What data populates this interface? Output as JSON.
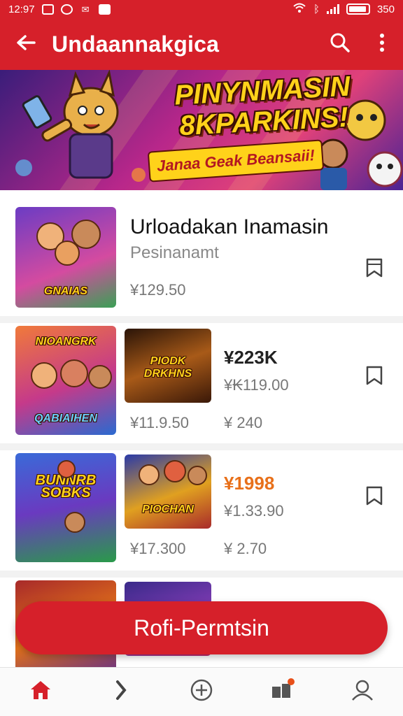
{
  "status_bar": {
    "time": "12:97",
    "battery": "350"
  },
  "app_bar": {
    "title": "Undaannakgica",
    "back_icon": "arrow-left-icon",
    "search_icon": "search-icon",
    "more_icon": "more-vert-icon"
  },
  "banner": {
    "headline_line1": "PINYNMASIN",
    "headline_line2": "8KPARKINS!",
    "subline": "Janaa Geak Beansaii!"
  },
  "items": [
    {
      "title": "Urloadakan Inamasin",
      "subtitle": "Pesinanamt",
      "thumb_label": "GNAIAS",
      "price": "¥129.50"
    },
    {
      "thumb_label": "QABIAIHEN",
      "thumb_label_top": "NIOANGRK",
      "price": "¥11.9.50",
      "second_thumb_label": "PIODK DRKHNS",
      "main_price": "¥223K",
      "old_price": "¥₭119.00",
      "second_price": "¥ 240"
    },
    {
      "thumb_label": "BUNNRB SOBKS",
      "price": "¥17.300",
      "second_thumb_label": "PIOCHAN",
      "main_price": "¥1998",
      "old_price": "¥1.33.90",
      "second_price": "¥ 2.70"
    }
  ],
  "cta": {
    "label": "Rofi-Permtsin"
  },
  "bottom_nav": {
    "items": [
      "home-icon",
      "arrow-right-icon",
      "add-circle-icon",
      "grid-icon",
      "person-icon"
    ]
  },
  "colors": {
    "primary": "#d6202a",
    "accent": "#ffd21a",
    "price_highlight": "#e8701a"
  }
}
